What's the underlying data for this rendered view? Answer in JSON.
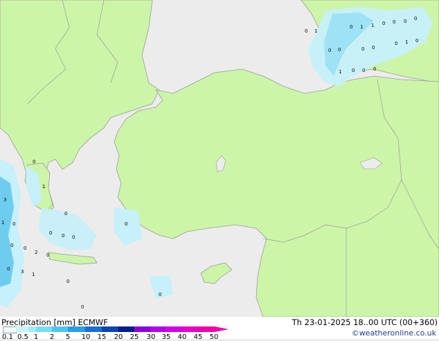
{
  "title": "Precipitation [mm] ECMWF",
  "datetime": "Th 23-01-2025 18..00 UTC (00+360)",
  "credit": "©weatheronline.co.uk",
  "legend": {
    "ticks": [
      "0.1",
      "0.5",
      "1",
      "2",
      "5",
      "10",
      "15",
      "20",
      "25",
      "30",
      "35",
      "40",
      "45",
      "50"
    ],
    "colors": [
      "#f0fcff",
      "#c8f4ff",
      "#a0ecfa",
      "#78dcf2",
      "#4bc8ea",
      "#2a9ee0",
      "#1a6fd0",
      "#0c44b0",
      "#061e8c",
      "#8c00d8",
      "#b400e6",
      "#d200e6",
      "#e600c8",
      "#f000a8"
    ]
  },
  "colors": {
    "land": "#ccf5a8",
    "sea": "#ececec",
    "precip_light": "#c6f0fa",
    "precip_medium": "#9ee2f6",
    "precip_heavy": "#6ecdee"
  },
  "point_labels": [
    "0",
    "1",
    "0",
    "1",
    "1",
    "0",
    "0",
    "0",
    "0",
    "1",
    "0",
    "0",
    "0",
    "0",
    "0",
    "1",
    "0",
    "0",
    "0",
    "0",
    "1",
    "3",
    "1",
    "0",
    "0",
    "0",
    "0",
    "0",
    "0",
    "0",
    "0",
    "2",
    "0",
    "3",
    "1",
    "0",
    "0",
    "0",
    "0",
    "0"
  ]
}
